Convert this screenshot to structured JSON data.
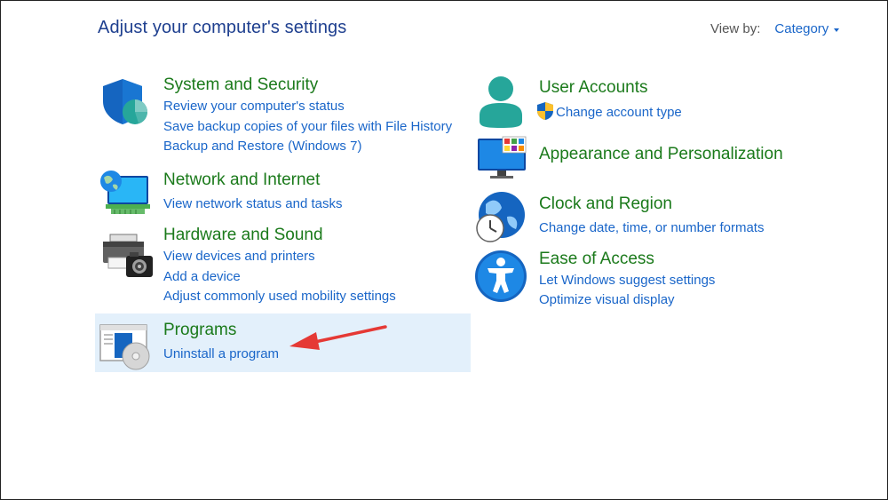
{
  "header": {
    "title": "Adjust your computer's settings",
    "view_by_label": "View by:",
    "view_by_value": "Category"
  },
  "left_column": {
    "system_security": {
      "title": "System and Security",
      "links": [
        "Review your computer's status",
        "Save backup copies of your files with File History",
        "Backup and Restore (Windows 7)"
      ]
    },
    "network_internet": {
      "title": "Network and Internet",
      "links": [
        "View network status and tasks"
      ]
    },
    "hardware_sound": {
      "title": "Hardware and Sound",
      "links": [
        "View devices and printers",
        "Add a device",
        "Adjust commonly used mobility settings"
      ]
    },
    "programs": {
      "title": "Programs",
      "links": [
        "Uninstall a program"
      ]
    }
  },
  "right_column": {
    "user_accounts": {
      "title": "User Accounts",
      "links": [
        "Change account type"
      ]
    },
    "appearance": {
      "title": "Appearance and Personalization"
    },
    "clock_region": {
      "title": "Clock and Region",
      "links": [
        "Change date, time, or number formats"
      ]
    },
    "ease_access": {
      "title": "Ease of Access",
      "links": [
        "Let Windows suggest settings",
        "Optimize visual display"
      ]
    }
  },
  "colors": {
    "title_blue": "#1e3f8f",
    "link_blue": "#1a66c9",
    "category_green": "#1b7a1b",
    "highlight": "#e3f0fb",
    "annotation_arrow": "#e53935"
  }
}
